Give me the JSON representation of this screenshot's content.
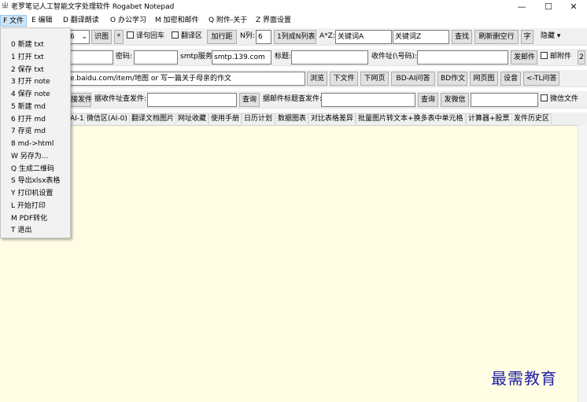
{
  "window": {
    "icon": "notepad-icon",
    "title": "老罗笔记人工智能文字处理软件 Rogabet Notepad",
    "minimize": "—",
    "maximize": "☐",
    "close": "✕"
  },
  "menubar": [
    "F 文件",
    "E 编辑",
    "D 翻译朗读",
    "O 办公学习",
    "M 加密和邮件",
    "Q 附件-关于",
    "Z 界面设置"
  ],
  "toolbar1": {
    "font_size": "6",
    "recognize": "识图",
    "star": "*",
    "wrap_label": "译句回车",
    "translate_area_label": "翻译区",
    "line_spacing": "加行距",
    "n_cols_label": "N列:",
    "n_cols_value": "6",
    "one_to_n": "1列成N列表",
    "az_label": "A*Z:",
    "keyword_a": "关键词A",
    "keyword_z": "关键词Z",
    "find": "查找",
    "refresh": "刷新删空行",
    "char": "字",
    "hide": "隐藏",
    "hide_arrow": "▾"
  },
  "toolbar2": {
    "password_label": "密码:",
    "smtp_label": "smtp服务",
    "smtp_value": "smtp.139.com",
    "subject_label": "标题:",
    "recipient_label": "收件址(\\号码):",
    "send_mail": "发邮件",
    "attach_label": "邮附件",
    "extra": "2"
  },
  "toolbar3": {
    "url_value": "e.baidu.com/item/地图 or 写一篇关于母亲的作文",
    "browse": "浏览",
    "download_file": "下文件",
    "download_page": "下网页",
    "bd_ai": "BD-AI问答",
    "bd_essay": "BD作文",
    "webpage_img": "网页图",
    "music": "设音",
    "tl_qa": "<-TL问答"
  },
  "toolbar4": {
    "send_btn": "接发件",
    "search_sender_label": "据收件址查发件:",
    "query1": "查询",
    "search_subject_label": "据邮件标题查发件:",
    "query2": "查询",
    "send_wechat": "发微信",
    "wechat_file_label": "微信文件"
  },
  "tabs": [
    "AI-1)",
    "微信区(AI-0)",
    "翻译文档图片",
    "网址收藏",
    "使用手册",
    "日历计划",
    "数据图表",
    "对比表格差异",
    "批量图片转文本+换多表中单元格",
    "计算器+股票",
    "发件历史区"
  ],
  "file_menu": [
    "0 新建 txt",
    "1 打开 txt",
    "2 保存 txt",
    "3 打开 note",
    "4 保存 note",
    "5 新建 md",
    "6 打开 md",
    "7 存览 md",
    "8 md->html",
    "W 另存为...",
    "Q 生成二维码",
    "S 导出xlsx表格",
    "Y 打印机设置",
    "L 开始打印",
    "M PDF转化",
    "T 退出"
  ],
  "watermark": "最需教育"
}
